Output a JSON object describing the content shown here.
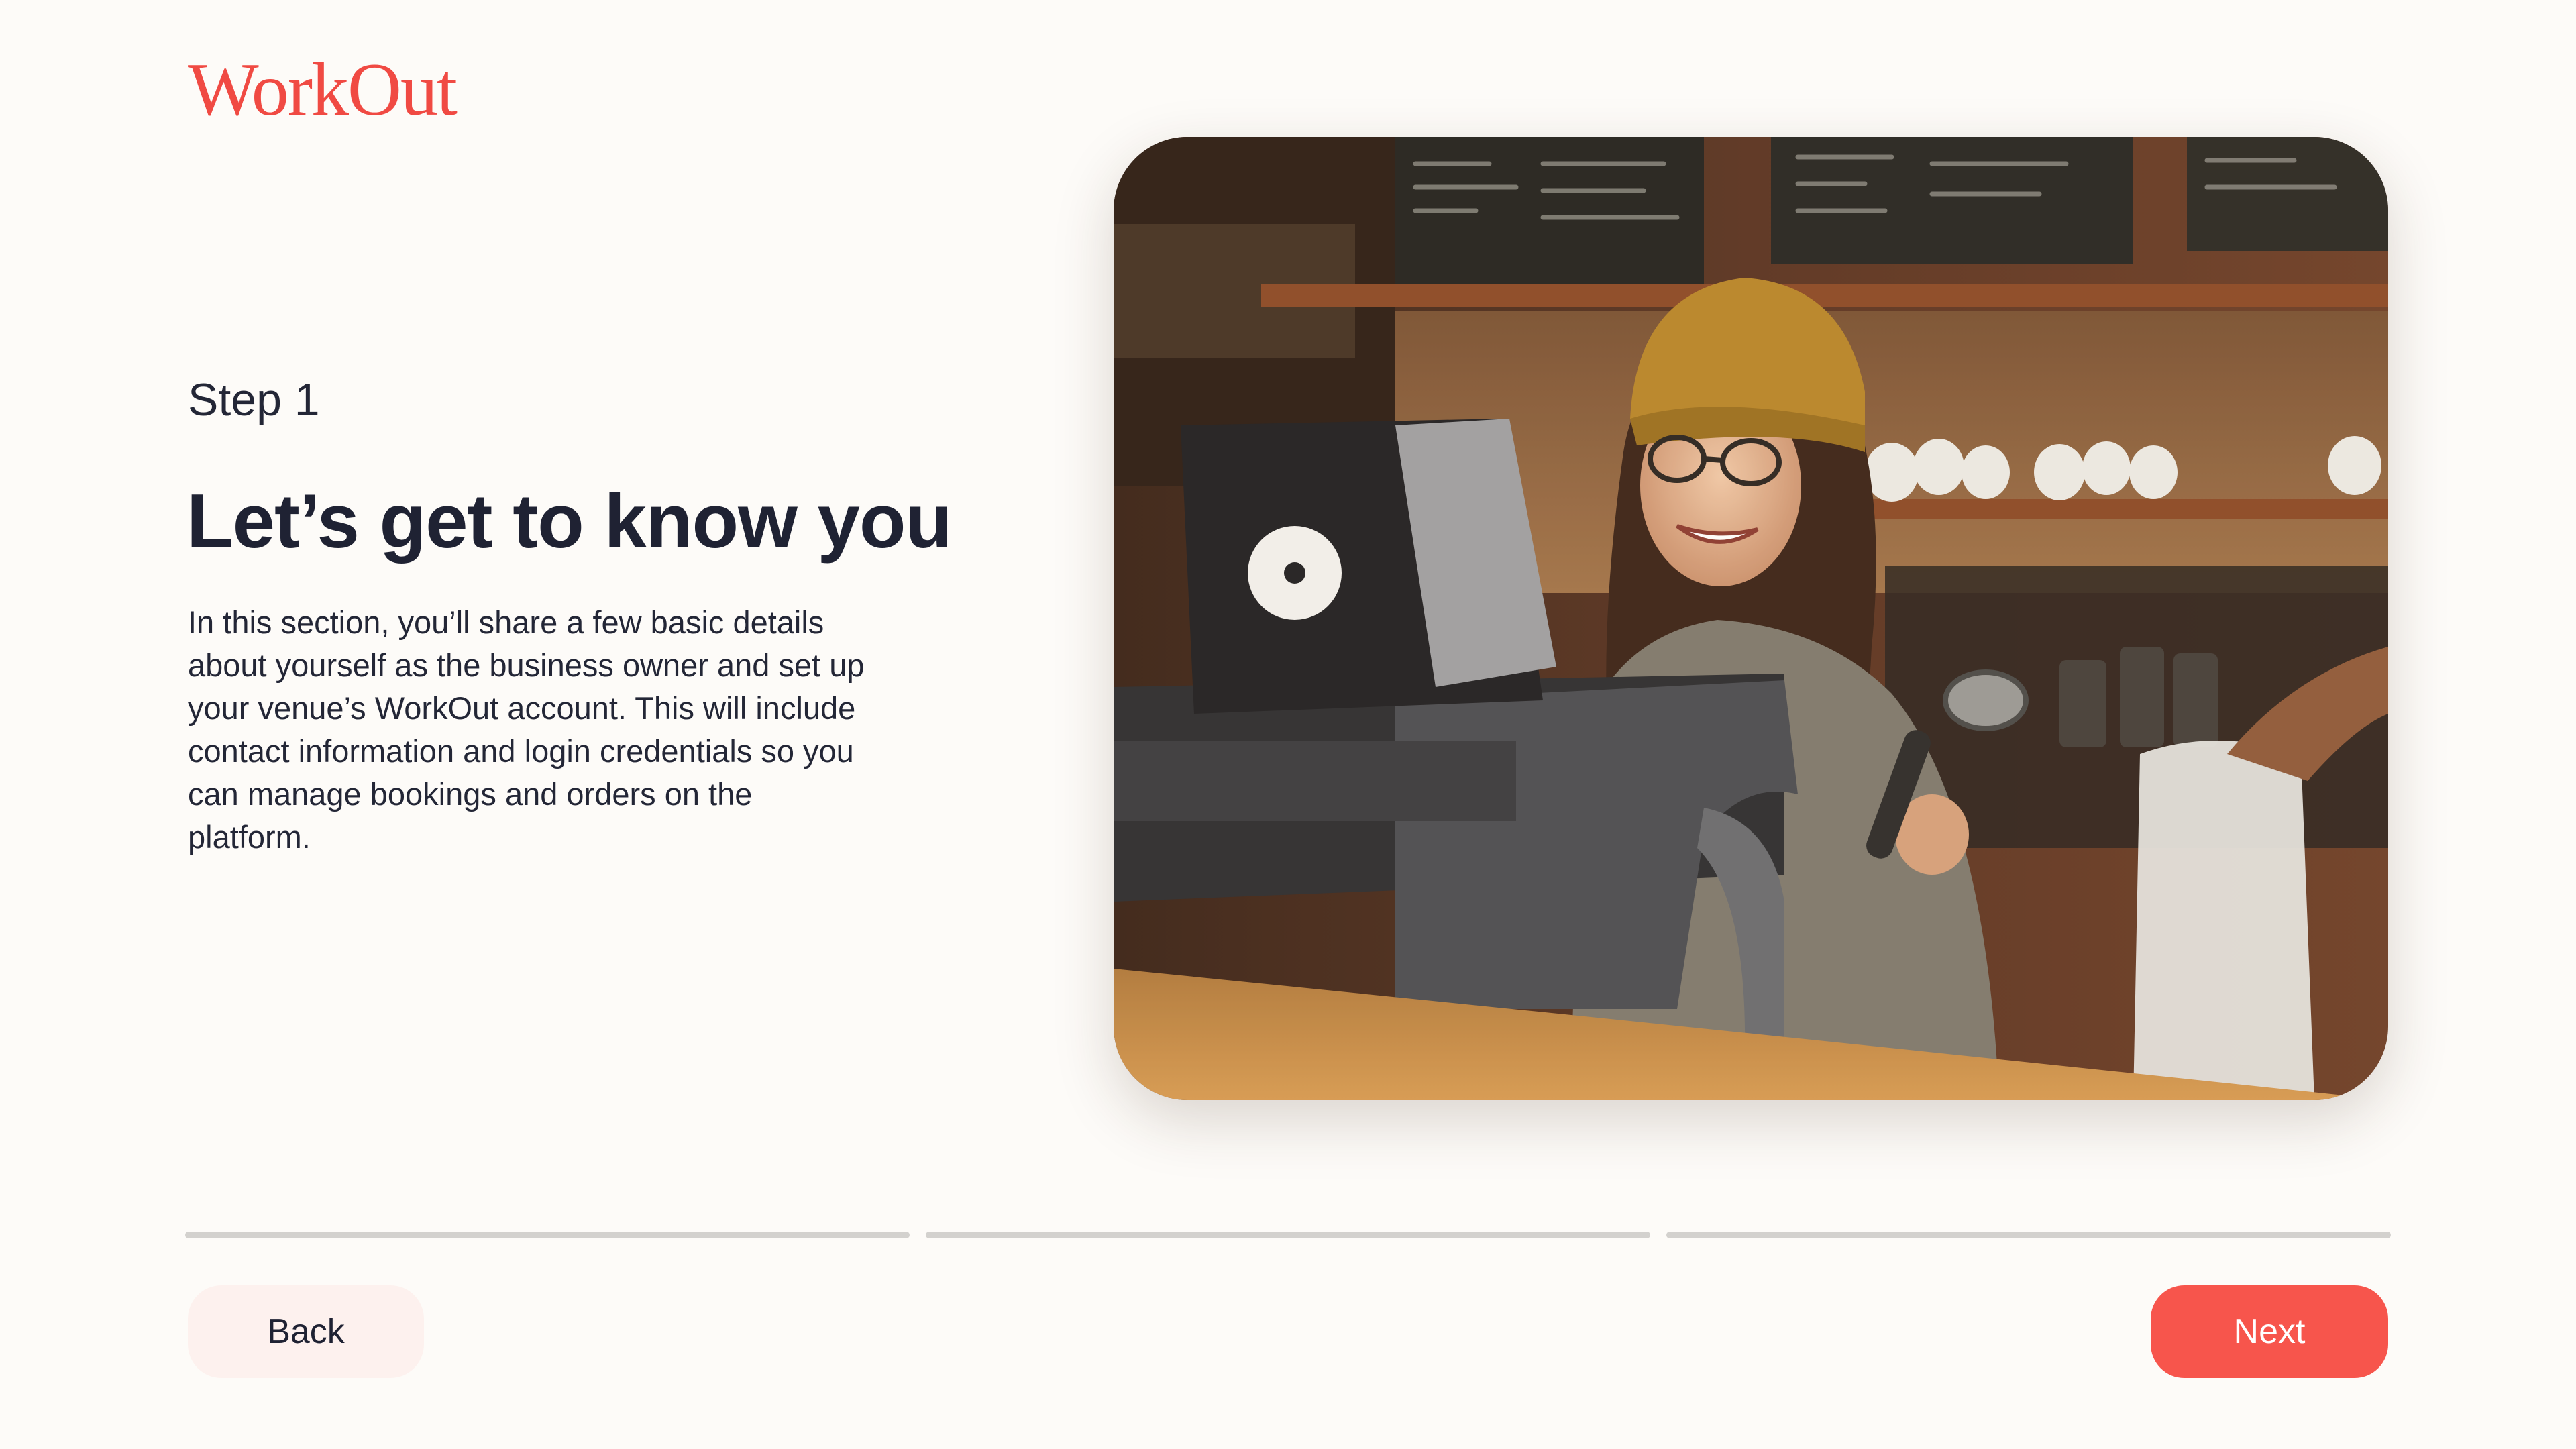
{
  "brand": {
    "name": "WorkOut",
    "color": "#f04a43"
  },
  "intro": {
    "step_label": "Step 1",
    "title": "Let’s get to know you",
    "description": "In this section, you’ll share a few basic details about yourself as the business owner and set up your venue’s WorkOut account. This will include contact information and login credentials so you can manage bookings and orders on the platform."
  },
  "hero_image": {
    "icon": "photo-barista-cafe"
  },
  "progress": {
    "total_steps": 3,
    "current_step": 1,
    "track_color": "#d3d1ce"
  },
  "actions": {
    "back_label": "Back",
    "next_label": "Next",
    "next_color": "#f7554c"
  }
}
